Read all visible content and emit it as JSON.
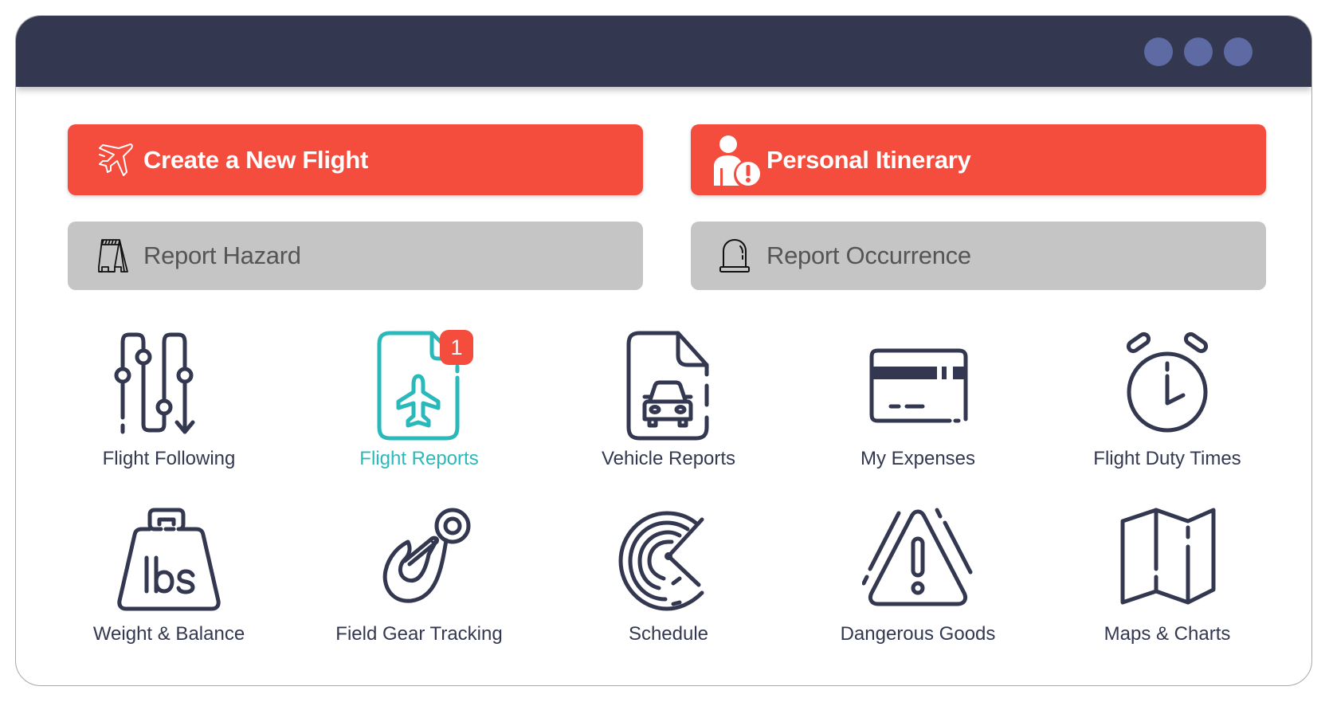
{
  "window": {
    "titlebar_dots": [
      "dot-1",
      "dot-2",
      "dot-3"
    ]
  },
  "actions": {
    "create_flight": {
      "label": "Create a New Flight",
      "icon": "airplane-takeoff-icon"
    },
    "personal_itinerary": {
      "label": "Personal Itinerary",
      "icon": "person-alert-icon"
    },
    "report_hazard": {
      "label": "Report Hazard",
      "icon": "hazard-sign-icon"
    },
    "report_occurrence": {
      "label": "Report Occurrence",
      "icon": "beacon-light-icon"
    }
  },
  "tiles": [
    {
      "label": "Flight Following",
      "icon": "flight-path-icon"
    },
    {
      "label": "Flight Reports",
      "icon": "flight-report-document-icon",
      "badge": "1",
      "active": true
    },
    {
      "label": "Vehicle Reports",
      "icon": "vehicle-report-document-icon"
    },
    {
      "label": "My Expenses",
      "icon": "credit-card-icon"
    },
    {
      "label": "Flight Duty Times",
      "icon": "alarm-clock-icon"
    },
    {
      "label": "Weight & Balance",
      "icon": "weight-lbs-icon"
    },
    {
      "label": "Field Gear Tracking",
      "icon": "hook-icon"
    },
    {
      "label": "Schedule",
      "icon": "radar-icon"
    },
    {
      "label": "Dangerous Goods",
      "icon": "warning-triangle-icon"
    },
    {
      "label": "Maps & Charts",
      "icon": "folded-map-icon"
    }
  ],
  "colors": {
    "titlebar": "#333850",
    "titlebar_dot": "#5d6aa3",
    "primary_button": "#f44c3d",
    "secondary_button": "#c5c5c5",
    "icon": "#333850",
    "active": "#2ab9bb",
    "badge": "#f44c3d"
  }
}
